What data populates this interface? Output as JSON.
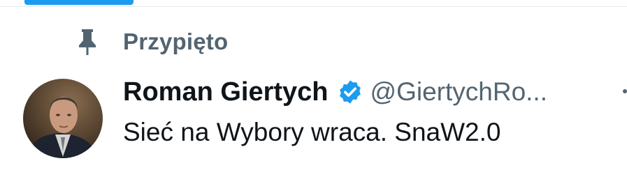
{
  "pinned": {
    "label": "Przypięto",
    "icon": "pin-icon"
  },
  "tweet": {
    "display_name": "Roman Giertych",
    "handle": "@GiertychRo...",
    "verified": true,
    "verified_icon": "verified-badge-icon",
    "text": "Sieć na Wybory wraca. SnaW2.0",
    "avatar_icon": "avatar"
  },
  "colors": {
    "accent": "#1d9bf0",
    "muted": "#536471",
    "text": "#0f1419"
  }
}
